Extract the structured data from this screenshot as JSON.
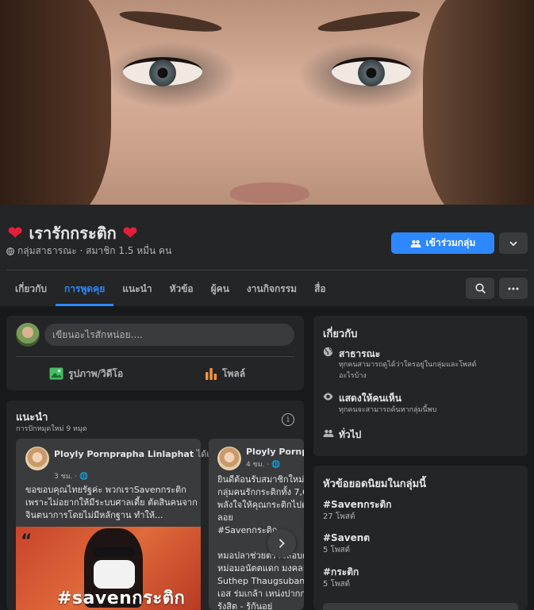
{
  "group": {
    "title": "เรารักกระติก",
    "meta": "กลุ่มสาธารณะ · สมาชิก 1.5 หมื่น คน",
    "join_label": "เข้าร่วมกลุ่ม"
  },
  "tabs": [
    "เกี่ยวกับ",
    "การพูดคุย",
    "แนะนำ",
    "หัวข้อ",
    "ผู้คน",
    "งานกิจกรรม",
    "สื่อ"
  ],
  "composer": {
    "placeholder": "เขียนอะไรสักหน่อย....",
    "photo_label": "รูปภาพ/วิดีโอ",
    "poll_label": "โพลล์"
  },
  "suggested": {
    "title": "แนะนำ",
    "subtitle": "การปักหมุดใหม่ 9 หมุด",
    "posts": [
      {
        "author": "Ployly Pornprapha Linlaphat",
        "action": " ได้แชร์ลิงก์",
        "time": "3 ชม. ·",
        "text": "ขอขอบคุณไทยรัฐค่ะ พวกเราSavenกระติก\nเพราะไม่อยากให้มีระบบศาลเตี้ย ตัดสินคนจาก\nจินตนาการโดยไม่มีหลักฐาน ทำให้...",
        "image_caption": "#savenกระติก"
      },
      {
        "author": "Ployly Pornpra",
        "time": "4 ชม. ·",
        "text": "ยินดีต้อนรับสมาชิกใหม่ทุ\nกลุ่มคนรักกระติกทั้ง 7,60\nพลังใจให้คุณกระติกไปด้\nลอย\n#Savenกระติก\n\nหมอปลาช่วยตรวจสอบด้วยนะ\nหม่อมอนัตตแดก มงคลกิต\nSuthep Thaugsuban (a\nเอส ร่มเกล้า เหน่งปากก\nรังสิต - รู้กันอยู่"
      }
    ]
  },
  "about": {
    "title": "เกี่ยวกับ",
    "rows": [
      {
        "title": "สาธารณะ",
        "desc": "ทุกคนสามารถดูได้ว่าใครอยู่ในกลุ่มและโพสต์\nอะไรบ้าง"
      },
      {
        "title": "แสดงให้คนเห็น",
        "desc": "ทุกคนจะสามารถค้นหากลุ่มนี้พบ"
      },
      {
        "title": "ทั่วไป"
      }
    ]
  },
  "topics": {
    "title": "หัวข้อยอดนิยมในกลุ่มนี้",
    "items": [
      {
        "name": "#Savenกระติก",
        "count": "27 โพสต์"
      },
      {
        "name": "#Savenต",
        "count": "5 โพสต์"
      },
      {
        "name": "#กระติก",
        "count": "5 โพสต์"
      }
    ]
  },
  "colors": {
    "background": "#18191a",
    "card": "#242526",
    "accent": "#2d88ff",
    "heart": "#e41e3f"
  }
}
